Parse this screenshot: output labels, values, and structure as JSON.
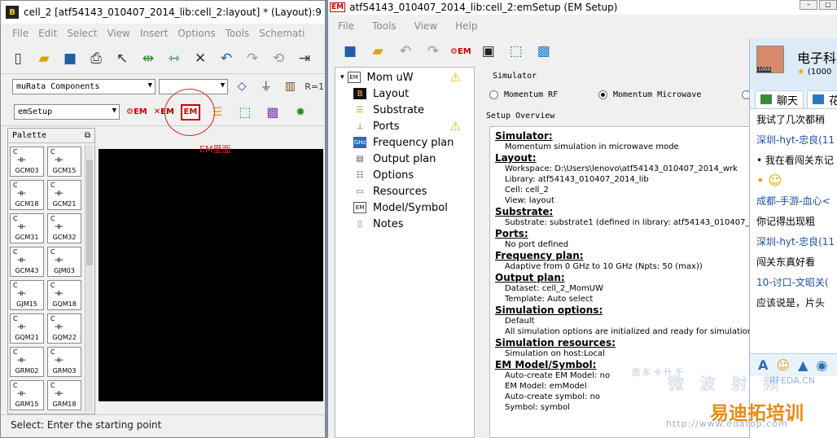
{
  "left_window": {
    "title": "cell_2 [atf54143_010407_2014_lib:cell_2:layout] * (Layout):9",
    "app_icon": "B",
    "menu": [
      "File",
      "Edit",
      "Select",
      "View",
      "Insert",
      "Options",
      "Tools",
      "Schemati"
    ],
    "toolbar2": {
      "library_combo": "muRata Components",
      "second_combo": "",
      "r_label": "R=1"
    },
    "toolbar3": {
      "combo": "emSetup",
      "em_label": "EM"
    },
    "annotation": "EM里面",
    "palette": {
      "title": "Palette",
      "items": [
        {
          "prefix": "C",
          "name": "GCM03"
        },
        {
          "prefix": "C",
          "name": "GCM15"
        },
        {
          "prefix": "C",
          "name": "GCM18"
        },
        {
          "prefix": "C",
          "name": "GCM21"
        },
        {
          "prefix": "C",
          "name": "GCM31"
        },
        {
          "prefix": "C",
          "name": "GCM32"
        },
        {
          "prefix": "C",
          "name": "GCM43"
        },
        {
          "prefix": "C",
          "name": "GJM03"
        },
        {
          "prefix": "C",
          "name": "GJM15"
        },
        {
          "prefix": "C",
          "name": "GQM18"
        },
        {
          "prefix": "C",
          "name": "GQM21"
        },
        {
          "prefix": "C",
          "name": "GQM22"
        },
        {
          "prefix": "C",
          "name": "GRM02"
        },
        {
          "prefix": "C",
          "name": "GRM03"
        },
        {
          "prefix": "C",
          "name": "GRM15"
        },
        {
          "prefix": "C",
          "name": "GRM18"
        }
      ]
    },
    "status": "Select: Enter the starting point"
  },
  "em_window": {
    "title": "atf54143_010407_2014_lib:cell_2:emSetup (EM Setup)",
    "title_icon": "EM",
    "menu": [
      "File",
      "Tools",
      "View",
      "Help"
    ],
    "tree": {
      "root": "Mom uW",
      "items": [
        "Layout",
        "Substrate",
        "Ports",
        "Frequency plan",
        "Output plan",
        "Options",
        "Resources",
        "Model/Symbol",
        "Notes"
      ]
    },
    "simulator": {
      "label": "Simulator",
      "options": [
        "Momentum RF",
        "Momentum Microwave"
      ],
      "selected": "Momentum Microwave"
    },
    "overview_label": "Setup Overview",
    "overview": [
      {
        "heading": "Simulator:",
        "lines": [
          "Momentum simulation in microwave mode"
        ]
      },
      {
        "heading": "Layout:",
        "lines": [
          "Workspace: D:\\Users\\lenovo\\atf54143_010407_2014_wrk",
          "Library: atf54143_010407_2014_lib",
          "Cell: cell_2",
          "View: layout"
        ]
      },
      {
        "heading": "Substrate:",
        "lines": [
          "Substrate: substrate1 (defined in library: atf54143_010407_20"
        ]
      },
      {
        "heading": "Ports:",
        "lines": [
          "No port defined"
        ]
      },
      {
        "heading": "Frequency plan:",
        "lines": [
          "Adaptive from 0 GHz to 10 GHz (Npts: 50 (max))"
        ]
      },
      {
        "heading": "Output plan:",
        "lines": [
          "Dataset: cell_2_MomUW",
          "Template: Auto select"
        ]
      },
      {
        "heading": "Simulation options:",
        "lines": [
          "Default",
          "All simulation options are initialized and ready for simulation."
        ]
      },
      {
        "heading": "Simulation resources:",
        "lines": [
          "Simulation on host:Local"
        ]
      },
      {
        "heading": "EM Model/Symbol:",
        "lines": [
          "Auto-create EM Model: no",
          "EM Model: emModel",
          "Auto-create symbol: no",
          "Symbol: symbol"
        ]
      }
    ]
  },
  "chat": {
    "name": "电子科",
    "number": "(1000",
    "badge": "1000",
    "tab_chat": "聊天",
    "tab_other": "花",
    "messages": [
      {
        "type": "text",
        "text": "我试了几次都稍"
      },
      {
        "type": "sender",
        "text": "深圳-hyt-忠良(11"
      },
      {
        "type": "text",
        "text": "• 我在看闯关东记"
      },
      {
        "type": "emoji",
        "text": "• ☺"
      },
      {
        "type": "sender",
        "text": "成都-手游-血心<"
      },
      {
        "type": "text",
        "text": "你记得出现粗"
      },
      {
        "type": "sender",
        "text": "深圳-hyt-忠良(11"
      },
      {
        "type": "text",
        "text": "闯关东真好看"
      },
      {
        "type": "sender",
        "text": "10-讨口-文昭关("
      },
      {
        "type": "text",
        "text": "应该说是，片头"
      }
    ]
  },
  "watermarks": {
    "top_small": "图 东 卡 什 千",
    "line1": "微 波 射 频",
    "brand": "易迪拓培训",
    "url": "http://www.edatop.com",
    "rfeda": "RFEDA.CN"
  }
}
